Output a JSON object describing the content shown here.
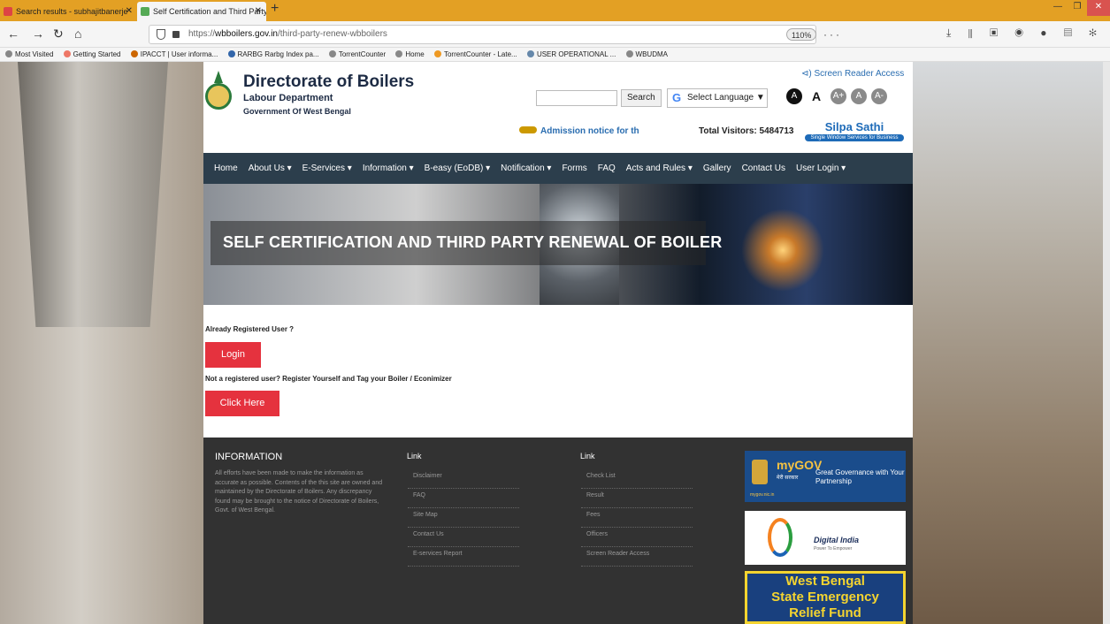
{
  "browser": {
    "tabs": [
      {
        "title": "Search results - subhajitbanerje"
      },
      {
        "title": "Self Certification and Third Party Re"
      }
    ],
    "new_tab": "+",
    "url_prefix": "https://",
    "url_domain": "wbboilers.gov.in",
    "url_path": "/third-party-renew-wbboilers",
    "zoom": "110%",
    "bookmarks": [
      "Most Visited",
      "Getting Started",
      "IPACCT | User informa...",
      "RARBG Rarbg Index pa...",
      "TorrentCounter",
      "Home",
      "TorrentCounter - Late...",
      "USER OPERATIONAL ...",
      "WBUDMA"
    ]
  },
  "header": {
    "title": "Directorate of Boilers",
    "subtitle1": "Labour Department",
    "subtitle2": "Government Of West Bengal",
    "search_button": "Search",
    "select_language": "Select Language",
    "screen_reader": "Screen Reader Access",
    "font_sizes": [
      "A",
      "A",
      "A+",
      "A",
      "A-"
    ],
    "admission": "Admission notice for th",
    "visitors_label": "Total Visitors: 5484713",
    "silpa_name": "Silpa Sathi",
    "silpa_sub": "Single Window Services for Business"
  },
  "menu": [
    "Home",
    "About Us",
    "E-Services",
    "Information",
    "B-easy (EoDB)",
    "Notification",
    "Forms",
    "FAQ",
    "Acts and Rules",
    "Gallery",
    "Contact Us",
    "User Login"
  ],
  "banner": {
    "title": "SELF CERTIFICATION AND THIRD PARTY RENEWAL OF BOILER"
  },
  "content": {
    "already_registered": "Already Registered User ?",
    "login": "Login",
    "not_registered": "Not a registered user? Register Yourself and Tag your Boiler / Econimizer",
    "click_here": "Click Here"
  },
  "footer": {
    "info_title": "INFORMATION",
    "info_text": "All efforts have been made to make the information as accurate as possible. Contents of the this site are owned and maintained by the Directorate of Boilers. Any discrepancy found may be brought to the notice of Directorate of Boilers, Govt. of West Bengal.",
    "link_title_1": "Link",
    "links_1": [
      "Disclaimer",
      "FAQ",
      "Site Map",
      "Contact Us",
      "E-services Report"
    ],
    "link_title_2": "Link",
    "links_2": [
      "Check List",
      "Result",
      "Fees",
      "Officers",
      "Screen Reader Access"
    ],
    "mygov_logo": "myGOV",
    "mygov_hindi": "मेरी सरकार",
    "mygov_tag": "Great Governance with Your Partnership",
    "mygov_url": "mygov.nic.in",
    "digital_title": "Digital India",
    "digital_sub": "Power To Empower",
    "wb_fund": [
      "West Bengal",
      "State Emergency",
      "Relief Fund"
    ]
  }
}
